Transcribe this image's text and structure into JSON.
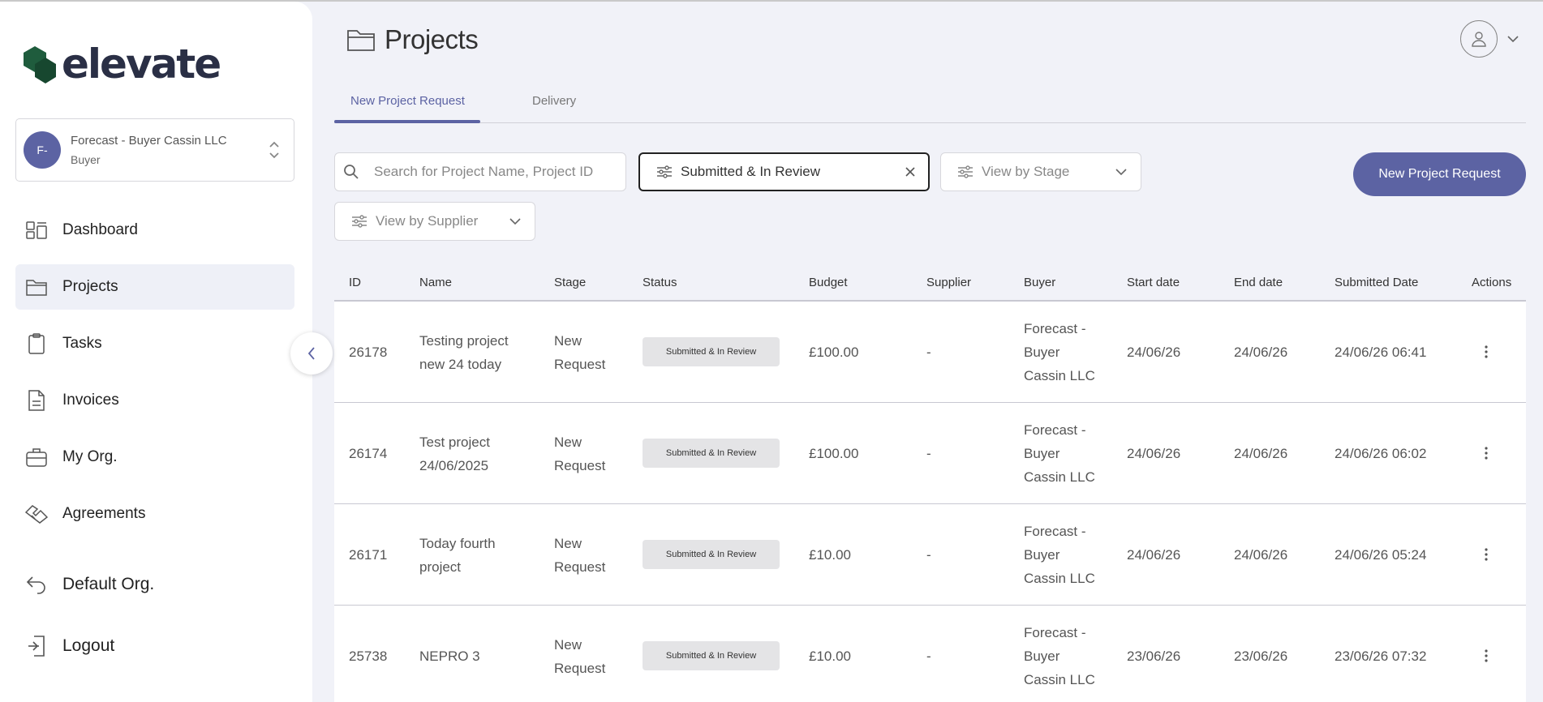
{
  "app": {
    "logo_text": "elevate"
  },
  "org_switcher": {
    "avatar_initials": "F-",
    "name": "Forecast - Buyer Cassin LLC",
    "role": "Buyer"
  },
  "sidebar": {
    "items": [
      {
        "label": "Dashboard",
        "icon": "dashboard-icon"
      },
      {
        "label": "Projects",
        "icon": "folder-icon",
        "active": true
      },
      {
        "label": "Tasks",
        "icon": "clipboard-icon"
      },
      {
        "label": "Invoices",
        "icon": "document-icon"
      },
      {
        "label": "My Org.",
        "icon": "briefcase-icon"
      },
      {
        "label": "Agreements",
        "icon": "handshake-icon"
      }
    ],
    "bottom": [
      {
        "label": "Default Org.",
        "icon": "return-icon"
      },
      {
        "label": "Logout",
        "icon": "logout-icon"
      }
    ]
  },
  "header": {
    "title": "Projects"
  },
  "tabs": [
    {
      "label": "New Project Request",
      "active": true
    },
    {
      "label": "Delivery"
    }
  ],
  "filters": {
    "search_placeholder": "Search for Project Name, Project ID",
    "status_filter": "Submitted & In Review",
    "stage_placeholder": "View by Stage",
    "supplier_placeholder": "View by Supplier"
  },
  "actions": {
    "new_request": "New Project Request"
  },
  "table": {
    "columns": [
      "ID",
      "Name",
      "Stage",
      "Status",
      "Budget",
      "Supplier",
      "Buyer",
      "Start date",
      "End date",
      "Submitted Date",
      "Actions"
    ],
    "rows": [
      {
        "id": "26178",
        "name": [
          "Testing project",
          "new 24 today"
        ],
        "stage": [
          "New",
          "Request"
        ],
        "status": "Submitted & In Review",
        "budget": "£100.00",
        "supplier": "-",
        "buyer": [
          "Forecast -",
          "Buyer",
          "Cassin LLC"
        ],
        "start": "24/06/26",
        "end": "24/06/26",
        "submitted": "24/06/26 06:41"
      },
      {
        "id": "26174",
        "name": [
          "Test project",
          "24/06/2025"
        ],
        "stage": [
          "New",
          "Request"
        ],
        "status": "Submitted & In Review",
        "budget": "£100.00",
        "supplier": "-",
        "buyer": [
          "Forecast -",
          "Buyer",
          "Cassin LLC"
        ],
        "start": "24/06/26",
        "end": "24/06/26",
        "submitted": "24/06/26 06:02"
      },
      {
        "id": "26171",
        "name": [
          "Today fourth",
          "project"
        ],
        "stage": [
          "New",
          "Request"
        ],
        "status": "Submitted & In Review",
        "budget": "£10.00",
        "supplier": "-",
        "buyer": [
          "Forecast -",
          "Buyer",
          "Cassin LLC"
        ],
        "start": "24/06/26",
        "end": "24/06/26",
        "submitted": "24/06/26 05:24"
      },
      {
        "id": "25738",
        "name": [
          "NEPRO 3"
        ],
        "stage": [
          "New",
          "Request"
        ],
        "status": "Submitted & In Review",
        "budget": "£10.00",
        "supplier": "-",
        "buyer": [
          "Forecast -",
          "Buyer",
          "Cassin LLC"
        ],
        "start": "23/06/26",
        "end": "23/06/26",
        "submitted": "23/06/26 07:32"
      }
    ]
  },
  "colors": {
    "accent": "#5c63a3",
    "logo_green": "#1f5c3d",
    "background": "#f1f2f8"
  }
}
